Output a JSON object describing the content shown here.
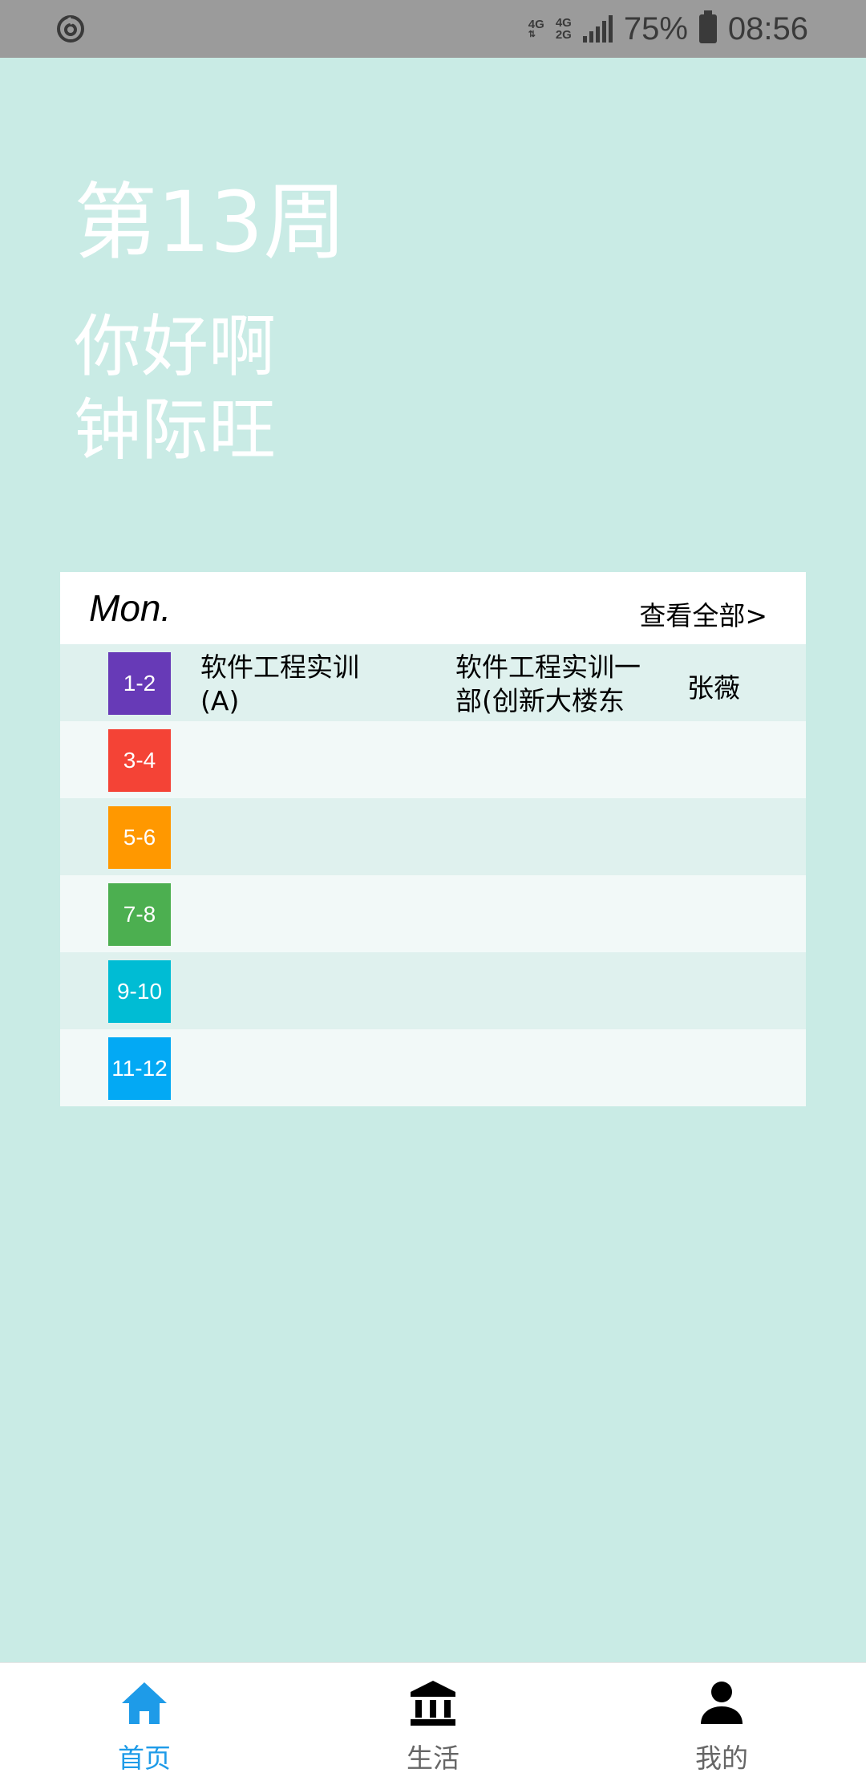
{
  "status_bar": {
    "network_top": "4G",
    "network_mid": "4G",
    "network_low": "2G",
    "battery": "75%",
    "time": "08:56"
  },
  "header": {
    "week": "第13周",
    "greeting_line1": "你好啊",
    "greeting_line2": "钟际旺"
  },
  "schedule": {
    "day": "Mon.",
    "view_all": "查看全部>",
    "rows": [
      {
        "period": "1-2",
        "color": "#673ab7",
        "course": "软件工程实训(A)",
        "place": "软件工程实训一部(创新大楼东",
        "teacher": "张薇"
      },
      {
        "period": "3-4",
        "color": "#f44336",
        "course": "",
        "place": "",
        "teacher": ""
      },
      {
        "period": "5-6",
        "color": "#ff9800",
        "course": "",
        "place": "",
        "teacher": ""
      },
      {
        "period": "7-8",
        "color": "#4caf50",
        "course": "",
        "place": "",
        "teacher": ""
      },
      {
        "period": "9-10",
        "color": "#00bcd4",
        "course": "",
        "place": "",
        "teacher": ""
      },
      {
        "period": "11-12",
        "color": "#03a9f4",
        "course": "",
        "place": "",
        "teacher": ""
      }
    ]
  },
  "bottom_nav": {
    "items": [
      {
        "label": "首页",
        "icon": "home-icon",
        "active": true
      },
      {
        "label": "生活",
        "icon": "bank-icon",
        "active": false
      },
      {
        "label": "我的",
        "icon": "person-icon",
        "active": false
      }
    ]
  },
  "colors": {
    "background": "#c9ebe5",
    "accent": "#1e9be8"
  }
}
